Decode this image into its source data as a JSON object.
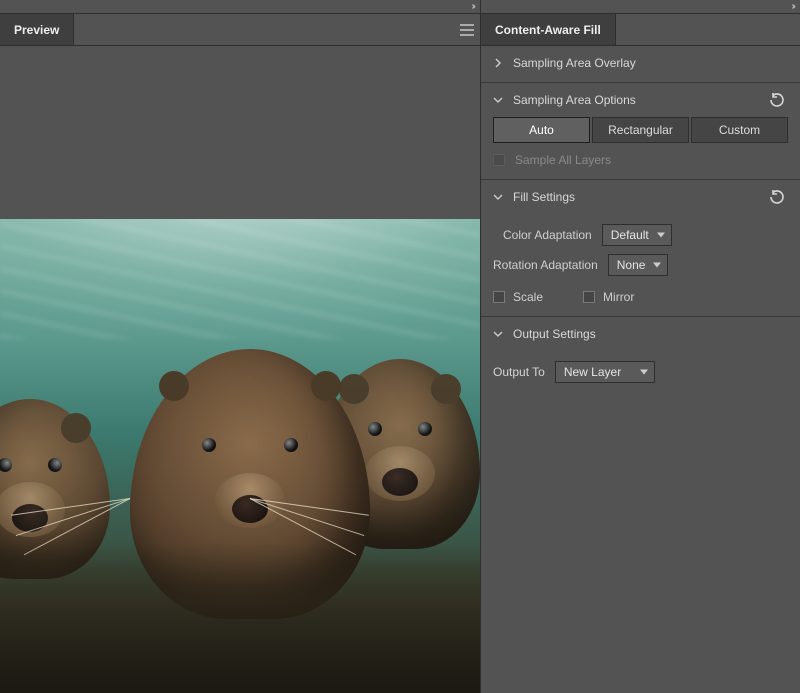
{
  "left": {
    "tab_title": "Preview"
  },
  "right": {
    "tab_title": "Content-Aware Fill",
    "sections": {
      "overlay": {
        "title": "Sampling Area Overlay",
        "expanded": false
      },
      "sampling": {
        "title": "Sampling Area Options",
        "expanded": true,
        "modes": [
          "Auto",
          "Rectangular",
          "Custom"
        ],
        "active_mode": "Auto",
        "sample_all_layers_label": "Sample All Layers",
        "sample_all_layers_checked": false,
        "sample_all_layers_enabled": false
      },
      "fill": {
        "title": "Fill Settings",
        "expanded": true,
        "color_adaptation_label": "Color Adaptation",
        "color_adaptation_value": "Default",
        "rotation_adaptation_label": "Rotation Adaptation",
        "rotation_adaptation_value": "None",
        "scale_label": "Scale",
        "scale_checked": false,
        "mirror_label": "Mirror",
        "mirror_checked": false
      },
      "output": {
        "title": "Output Settings",
        "expanded": true,
        "output_to_label": "Output To",
        "output_to_value": "New Layer"
      }
    }
  }
}
